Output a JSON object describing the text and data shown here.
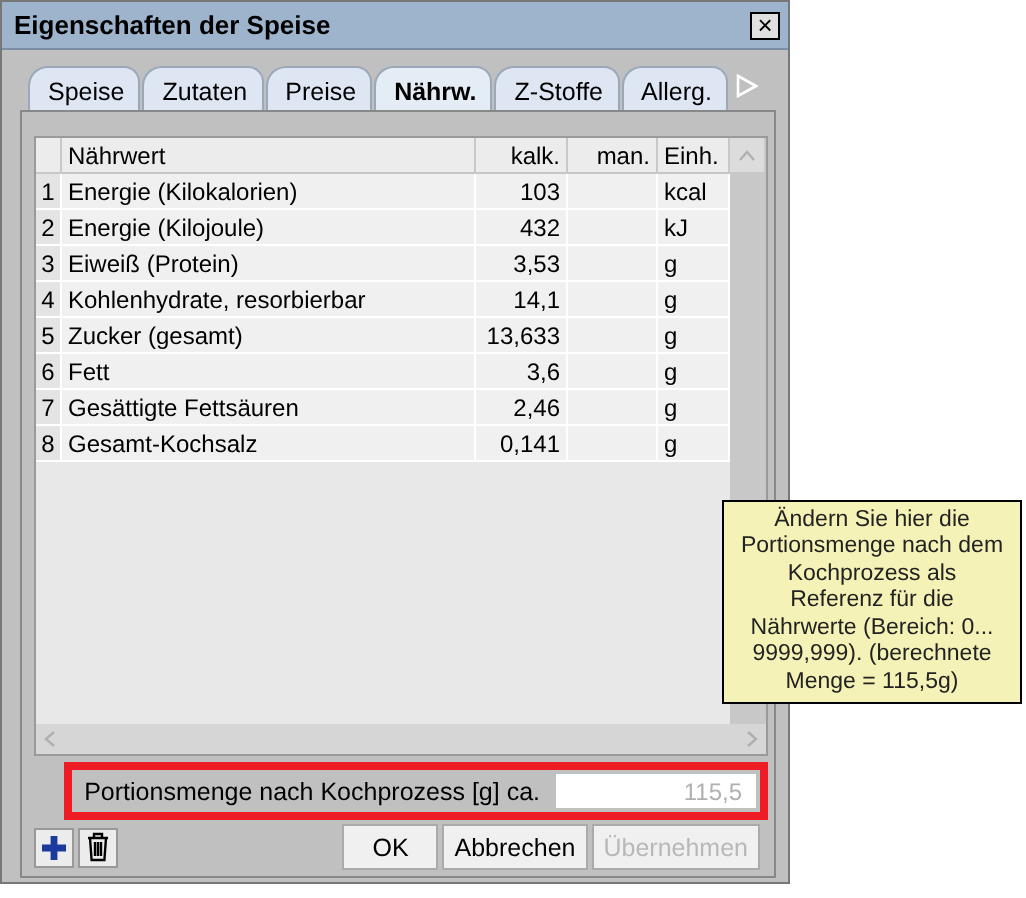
{
  "window": {
    "title": "Eigenschaften der Speise",
    "close_label": "×"
  },
  "tabs": [
    {
      "label": "Speise",
      "selected": false
    },
    {
      "label": "Zutaten",
      "selected": false
    },
    {
      "label": "Preise",
      "selected": false
    },
    {
      "label": "Nährw.",
      "selected": true
    },
    {
      "label": "Z-Stoffe",
      "selected": false
    },
    {
      "label": "Allerg.",
      "selected": false
    }
  ],
  "table": {
    "columns": [
      "Nährwert",
      "kalk.",
      "man.",
      "Einh."
    ],
    "rows": [
      {
        "index": "1",
        "name": "Energie (Kilokalorien)",
        "calc": "103",
        "unit": "kcal"
      },
      {
        "index": "2",
        "name": "Energie (Kilojoule)",
        "calc": "432",
        "unit": "kJ"
      },
      {
        "index": "3",
        "name": "Eiweiß (Protein)",
        "calc": "3,53",
        "unit": "g"
      },
      {
        "index": "4",
        "name": "Kohlenhydrate, resorbierbar",
        "calc": "14,1",
        "unit": "g"
      },
      {
        "index": "5",
        "name": "Zucker (gesamt)",
        "calc": "13,633",
        "unit": "g"
      },
      {
        "index": "6",
        "name": "Fett",
        "calc": "3,6",
        "unit": "g"
      },
      {
        "index": "7",
        "name": "Gesättigte Fettsäuren",
        "calc": "2,46",
        "unit": "g"
      },
      {
        "index": "8",
        "name": "Gesamt-Kochsalz",
        "calc": "0,141",
        "unit": "g"
      }
    ]
  },
  "portion": {
    "label": "Portionsmenge nach Kochprozess [g] ca.",
    "value": "115,5",
    "disabled": true,
    "highlighted": true
  },
  "buttons": [
    {
      "label": "OK",
      "disabled": false
    },
    {
      "label": "Abbrechen",
      "disabled": false
    },
    {
      "label": "Übernehmen",
      "disabled": true
    }
  ],
  "tooltip": {
    "text": "Ändern Sie hier die Portionsmenge nach dem Kochprozess als Referenz für die Nährwerte (Bereich: 0... 9999,999). (berechnete Menge = 115,5g)"
  }
}
